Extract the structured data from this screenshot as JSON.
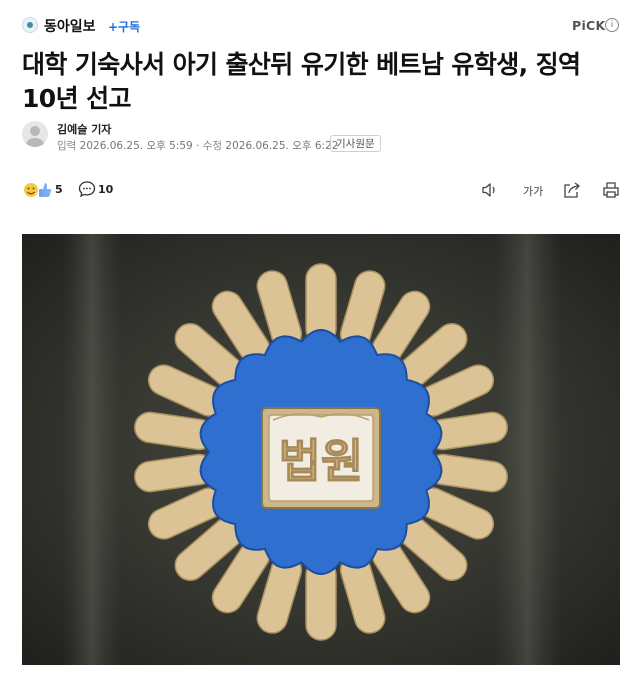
{
  "header": {
    "press_name": "동아일보",
    "subscribe_label": "+구독",
    "pick_label": "PiCK",
    "info_icon": "info-icon"
  },
  "article": {
    "title": "대학 기숙사서 아기 출산뒤 유기한 베트남 유학생, 징역 10년 선고"
  },
  "reporter": {
    "name": "김예슬 기자",
    "published_label": "입력",
    "published": "2026.06.25. 오후 5:59",
    "modified_label": "수정",
    "modified": "2026.06.25. 오후 6:22",
    "original_article_button": "기사원문"
  },
  "reactions": {
    "emotion_count": "5",
    "comment_count": "10"
  },
  "toolbar": {
    "audio_icon": "speaker-icon",
    "font_size_label": "가가",
    "share_icon": "share-icon",
    "print_icon": "print-icon"
  },
  "photo": {
    "emblem_text": "법원",
    "colors": {
      "petal": "#ddc49a",
      "blue": "#2f6fd0",
      "background": "#2e302c"
    }
  }
}
